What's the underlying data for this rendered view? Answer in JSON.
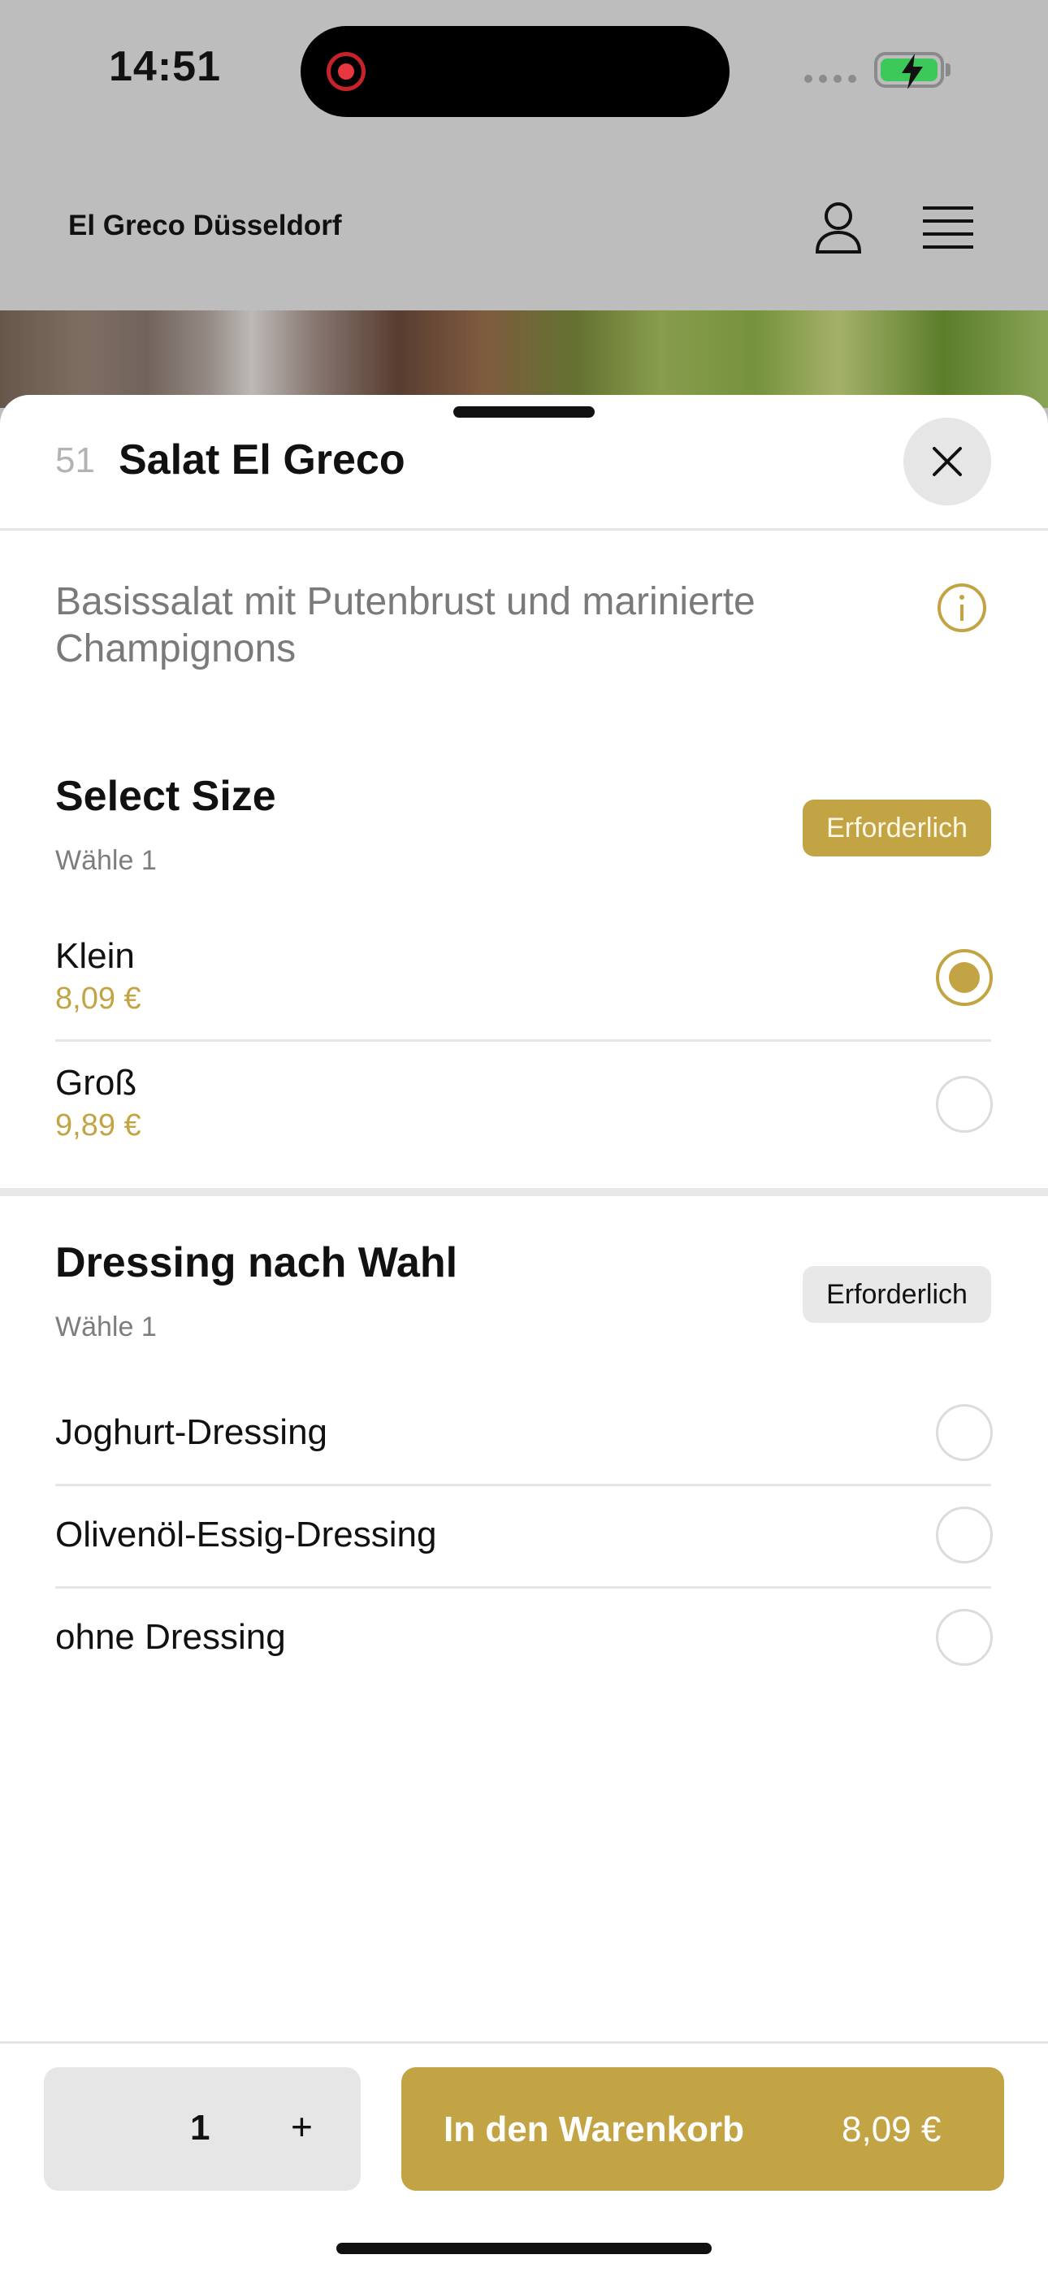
{
  "status_bar": {
    "time": "14:51"
  },
  "header": {
    "brand": "El Greco Düsseldorf"
  },
  "item": {
    "number": "51",
    "title": "Salat El Greco",
    "description": "Basissalat mit Putenbrust und marinierte Champignons"
  },
  "sections": [
    {
      "title": "Select Size",
      "subtitle": "Wähle 1",
      "badge": "Erforderlich",
      "options": [
        {
          "label": "Klein",
          "price": "8,09 €",
          "selected": true
        },
        {
          "label": "Groß",
          "price": "9,89 €",
          "selected": false
        }
      ]
    },
    {
      "title": "Dressing nach Wahl",
      "subtitle": "Wähle 1",
      "badge": "Erforderlich",
      "options": [
        {
          "label": "Joghurt-Dressing",
          "selected": false
        },
        {
          "label": "Olivenöl-Essig-Dressing",
          "selected": false
        },
        {
          "label": "ohne Dressing",
          "selected": false
        }
      ]
    }
  ],
  "footer": {
    "quantity": "1",
    "plus": "+",
    "cart_label": "In den Warenkorb",
    "cart_price": "8,09 €"
  },
  "colors": {
    "accent": "#c3a445",
    "badge_neutral": "#e8e8e8",
    "battery": "#3cc95a"
  },
  "icons": [
    "record-icon",
    "battery-icon",
    "user-icon",
    "menu-icon",
    "close-icon",
    "info-icon"
  ]
}
